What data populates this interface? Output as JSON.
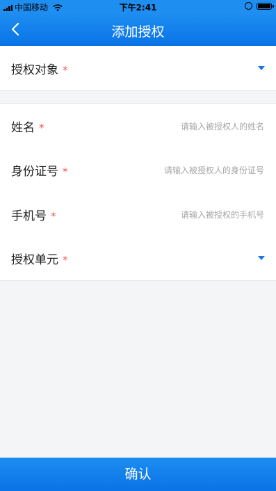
{
  "status_bar": {
    "carrier": "中国移动",
    "time": "下午2:41"
  },
  "nav": {
    "title": "添加授权",
    "back_icon": "chevron-left-icon"
  },
  "form": {
    "auth_target": {
      "label": "授权对象",
      "required_mark": "*"
    },
    "name": {
      "label": "姓名",
      "required_mark": "*",
      "placeholder": "请输入被授权人的姓名"
    },
    "id_number": {
      "label": "身份证号",
      "required_mark": "*",
      "placeholder": "请输入被授权人的身份证号"
    },
    "phone": {
      "label": "手机号",
      "required_mark": "*",
      "placeholder": "请输入被授权的手机号"
    },
    "auth_unit": {
      "label": "授权单元",
      "required_mark": "*"
    }
  },
  "confirm_label": "确认",
  "colors": {
    "brand": "#0a73e6",
    "required": "#f05454",
    "placeholder": "#a6a6a6",
    "page_bg": "#f3f5f7"
  }
}
